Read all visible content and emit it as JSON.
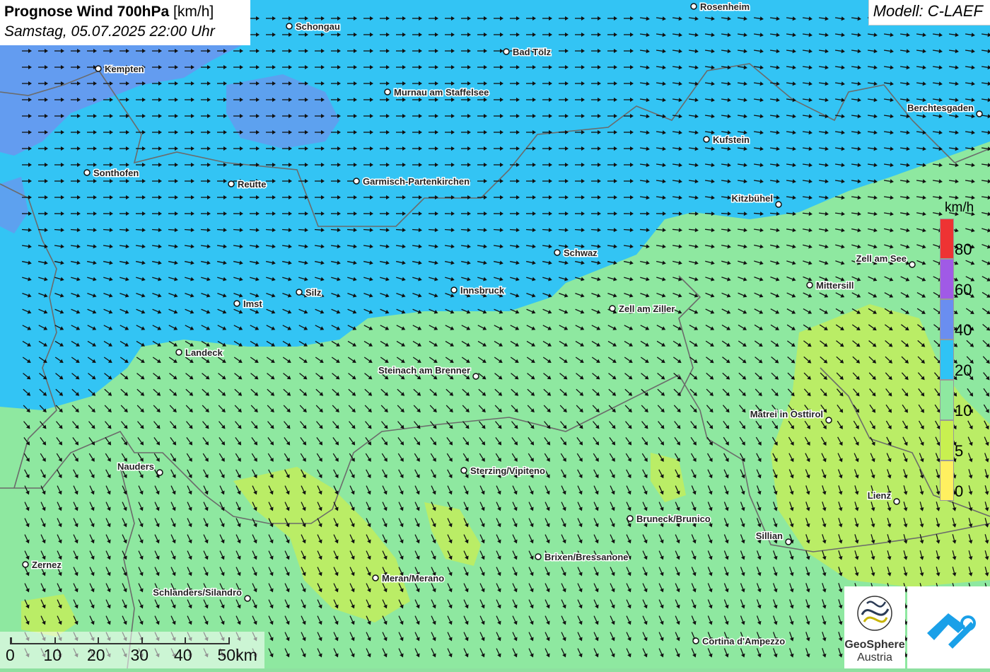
{
  "title": {
    "main": "Prognose Wind 700hPa",
    "unit": "[km/h]",
    "datetime": "Samstag, 05.07.2025 22:00 Uhr"
  },
  "model": "Modell: C-LAEF",
  "legend": {
    "unit": "km/h",
    "labels": [
      "80",
      "60",
      "40",
      "20",
      "10",
      "5",
      "0"
    ],
    "colors": [
      "#ee3333",
      "#a05ae6",
      "#6a8ef0",
      "#2fc3f5",
      "#8ee8a0",
      "#c8f050",
      "#fff060"
    ]
  },
  "scale": {
    "labels": [
      "0",
      "10",
      "20",
      "30",
      "40",
      "50km"
    ]
  },
  "logos": {
    "geosphere_line1": "GeoSphere",
    "geosphere_line2": "Austria"
  },
  "cities": [
    {
      "name": "Rosenheim"
    },
    {
      "name": "Schongau"
    },
    {
      "name": "Bad Tölz"
    },
    {
      "name": "Kempten"
    },
    {
      "name": "Murnau am Staffelsee"
    },
    {
      "name": "Berchtesgaden"
    },
    {
      "name": "Kufstein"
    },
    {
      "name": "Sonthofen"
    },
    {
      "name": "Reutte"
    },
    {
      "name": "Garmisch-Partenkirchen"
    },
    {
      "name": "Kitzbühel"
    },
    {
      "name": "Schwaz"
    },
    {
      "name": "Zell am See"
    },
    {
      "name": "Mittersill"
    },
    {
      "name": "Silz"
    },
    {
      "name": "Innsbruck"
    },
    {
      "name": "Imst"
    },
    {
      "name": "Zell am Ziller"
    },
    {
      "name": "Landeck"
    },
    {
      "name": "Steinach am Brenner"
    },
    {
      "name": "Matrei in Osttirol"
    },
    {
      "name": "Nauders"
    },
    {
      "name": "Sterzing/Vipiteno"
    },
    {
      "name": "Lienz"
    },
    {
      "name": "Bruneck/Brunico"
    },
    {
      "name": "Sillian"
    },
    {
      "name": "Brixen/Bressanone"
    },
    {
      "name": "Zernez"
    },
    {
      "name": "Meran/Merano"
    },
    {
      "name": "Schlanders/Silandro"
    },
    {
      "name": "Cortina d'Ampezzo"
    }
  ]
}
